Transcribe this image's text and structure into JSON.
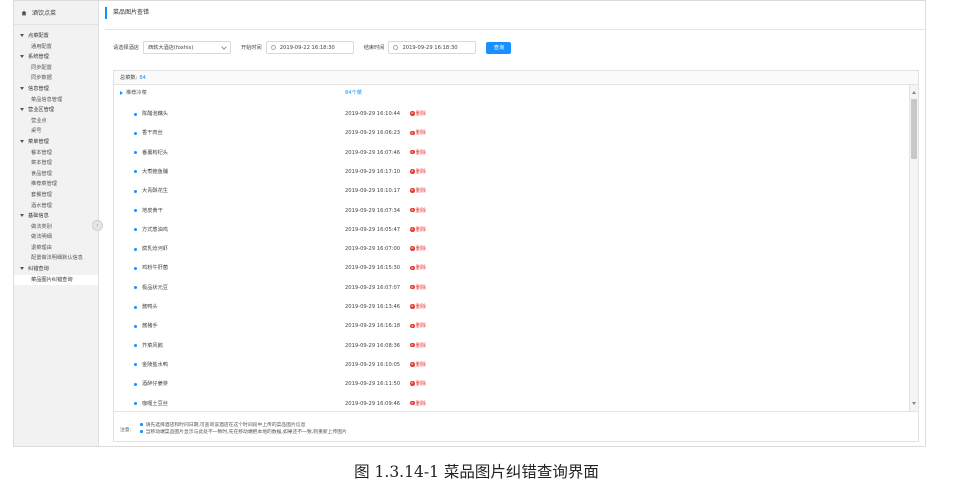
{
  "sidebar": {
    "header": "酒饮点菜",
    "items": [
      {
        "type": "group",
        "label": "点菜配置"
      },
      {
        "type": "sub",
        "label": "通用配置"
      },
      {
        "type": "group",
        "label": "系统管理"
      },
      {
        "type": "sub",
        "label": "同步配置"
      },
      {
        "type": "sub",
        "label": "同步数据"
      },
      {
        "type": "group",
        "label": "信息管理"
      },
      {
        "type": "sub",
        "label": "菜品信息管理"
      },
      {
        "type": "group",
        "label": "营业区管理"
      },
      {
        "type": "sub",
        "label": "营业点"
      },
      {
        "type": "sub",
        "label": "桌号"
      },
      {
        "type": "group",
        "label": "菜单管理"
      },
      {
        "type": "sub",
        "label": "餐本管理"
      },
      {
        "type": "sub",
        "label": "菜本管理"
      },
      {
        "type": "sub",
        "label": "食品管理"
      },
      {
        "type": "sub",
        "label": "推荐菜管理"
      },
      {
        "type": "sub",
        "label": "套餐管理"
      },
      {
        "type": "sub",
        "label": "酒水管理"
      },
      {
        "type": "group",
        "label": "基础信息"
      },
      {
        "type": "sub",
        "label": "做法类别"
      },
      {
        "type": "sub",
        "label": "做法明细"
      },
      {
        "type": "sub",
        "label": "退菜理由"
      },
      {
        "type": "sub",
        "label": "配置做法明细默认信息"
      },
      {
        "type": "group",
        "label": "纠错查询"
      },
      {
        "type": "sub",
        "label": "菜品图片纠错查询",
        "active": true
      }
    ]
  },
  "page": {
    "title": "菜品图片查错"
  },
  "filter": {
    "hotel_label": "请选择酒店",
    "hotel_value": "西软大酒店(foxhis)",
    "start_label": "开始时间",
    "start_value": "2019-09-22 16:18:30",
    "end_label": "结束时间",
    "end_value": "2019-09-29 16:18:30",
    "search_label": "查询"
  },
  "results": {
    "total_label": "总菜数:",
    "total_value": "84",
    "group_name": "推荐冷菜",
    "group_count": "84个菜",
    "delete_label": "删除",
    "rows": [
      {
        "name": "陈醋泡藕头",
        "time": "2019-09-29 16:10:44"
      },
      {
        "name": "香干肉丝",
        "time": "2019-09-29 16:06:23"
      },
      {
        "name": "番薯枸杞头",
        "time": "2019-09-29 16:07:46"
      },
      {
        "name": "大煮鲍鱼脯",
        "time": "2019-09-29 16:17:10"
      },
      {
        "name": "大青酥花生",
        "time": "2019-09-29 16:10:17"
      },
      {
        "name": "地皮黄干",
        "time": "2019-09-29 16:07:34"
      },
      {
        "name": "方式葱油鸡",
        "time": "2019-09-29 16:05:47"
      },
      {
        "name": "腐乳炝河虾",
        "time": "2019-09-29 16:07:00"
      },
      {
        "name": "鸡粉牛肝菌",
        "time": "2019-09-29 16:15:30"
      },
      {
        "name": "极品状元豆",
        "time": "2019-09-29 16:07:07"
      },
      {
        "name": "酱鸭头",
        "time": "2019-09-29 16:13:46"
      },
      {
        "name": "酱猪手",
        "time": "2019-09-29 16:16:18"
      },
      {
        "name": "芥菜风鹅",
        "time": "2019-09-29 16:08:36"
      },
      {
        "name": "金陵盐水鸭",
        "time": "2019-09-29 16:10:05"
      },
      {
        "name": "酒醉仔姜芽",
        "time": "2019-09-29 16:11:50"
      },
      {
        "name": "咖喱土豆丝",
        "time": "2019-09-29 16:09:46"
      }
    ]
  },
  "notes": {
    "label": "注意:",
    "line1": "请先选择酒店和时间日期,可查询该酒店在这个时间段中上传的菜品图片信息",
    "line2": "当移动端菜品图片显示与此处不一致时,先在移动端把本地的数据,如果还不一致,则重新上传图片"
  },
  "caption": "图 1.3.14-1 菜品图片纠错查询界面",
  "colors": {
    "accent": "#1890ff",
    "danger": "#e53935",
    "sidebar_bg": "#f2f2f2"
  }
}
